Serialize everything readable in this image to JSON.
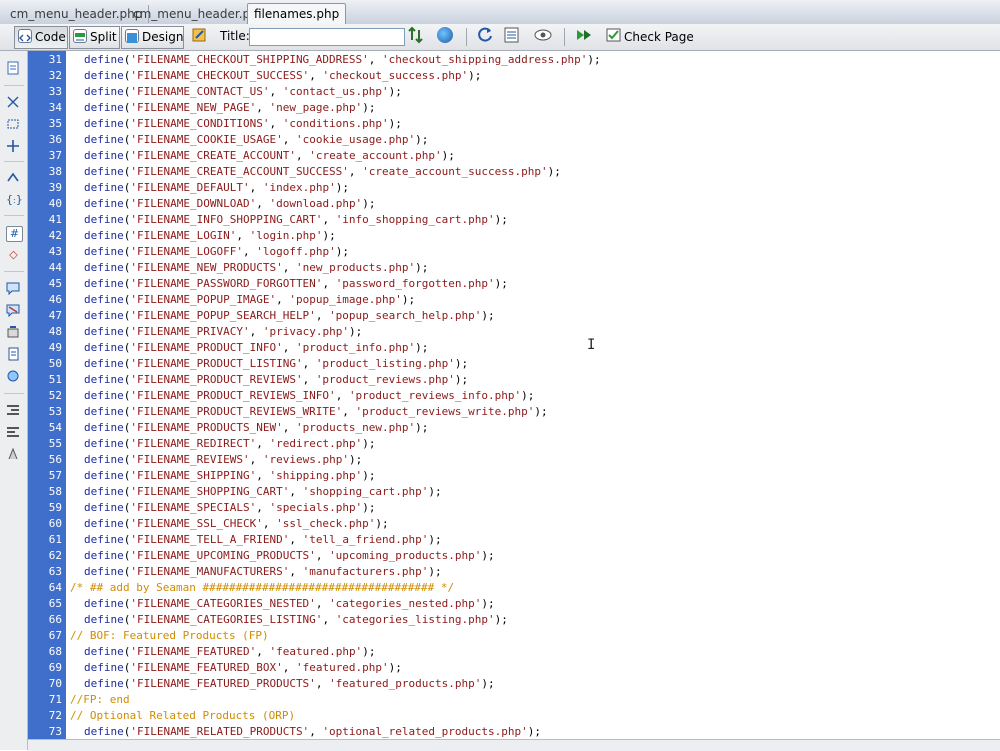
{
  "tabs": [
    {
      "label": "cm_menu_header.php",
      "active": false
    },
    {
      "label": "cm_menu_header.php",
      "active": false
    },
    {
      "label": "filenames.php",
      "active": true
    }
  ],
  "toolbar": {
    "code_label": "Code",
    "split_label": "Split",
    "design_label": "Design",
    "title_label": "Title:",
    "title_value": "",
    "check_page_label": "Check Page",
    "active_view": "Code"
  },
  "gutter_icons": [
    "document-icon",
    "collapse-icon",
    "expand-selection-icon",
    "expand-all-icon",
    "select-parent-icon",
    "balance-braces-icon",
    "line-numbers-icon",
    "highlight-invalid-icon",
    "apply-comment-icon",
    "remove-comment-icon",
    "wrap-tag-icon",
    "recent-snippets-icon",
    "move-css-icon",
    "indent-icon",
    "outdent-icon",
    "format-source-icon"
  ],
  "colors": {
    "gutter_blue": "#3f6fcb",
    "function": "#1f2b9c",
    "string": "#8b1a1a",
    "comment": "#d08c00",
    "highlight": "#fbe8ea"
  },
  "code": {
    "lines": [
      {
        "num": "31",
        "text": "define('FILENAME_CHECKOUT_SHIPPING_ADDRESS', 'checkout_shipping_address.php');"
      },
      {
        "num": "32",
        "text": "define('FILENAME_CHECKOUT_SUCCESS', 'checkout_success.php');"
      },
      {
        "num": "33",
        "text": "define('FILENAME_CONTACT_US', 'contact_us.php');"
      },
      {
        "num": "34",
        "text": "define('FILENAME_NEW_PAGE', 'new_page.php');",
        "highlight": true
      },
      {
        "num": "35",
        "text": "define('FILENAME_CONDITIONS', 'conditions.php');"
      },
      {
        "num": "36",
        "text": "define('FILENAME_COOKIE_USAGE', 'cookie_usage.php');"
      },
      {
        "num": "37",
        "text": "define('FILENAME_CREATE_ACCOUNT', 'create_account.php');"
      },
      {
        "num": "38",
        "text": "define('FILENAME_CREATE_ACCOUNT_SUCCESS', 'create_account_success.php');"
      },
      {
        "num": "39",
        "text": "define('FILENAME_DEFAULT', 'index.php');"
      },
      {
        "num": "40",
        "text": "define('FILENAME_DOWNLOAD', 'download.php');"
      },
      {
        "num": "41",
        "text": "define('FILENAME_INFO_SHOPPING_CART', 'info_shopping_cart.php');"
      },
      {
        "num": "42",
        "text": "define('FILENAME_LOGIN', 'login.php');"
      },
      {
        "num": "43",
        "text": "define('FILENAME_LOGOFF', 'logoff.php');"
      },
      {
        "num": "44",
        "text": "define('FILENAME_NEW_PRODUCTS', 'new_products.php');"
      },
      {
        "num": "45",
        "text": "define('FILENAME_PASSWORD_FORGOTTEN', 'password_forgotten.php');"
      },
      {
        "num": "46",
        "text": "define('FILENAME_POPUP_IMAGE', 'popup_image.php');"
      },
      {
        "num": "47",
        "text": "define('FILENAME_POPUP_SEARCH_HELP', 'popup_search_help.php');"
      },
      {
        "num": "48",
        "text": "define('FILENAME_PRIVACY', 'privacy.php');"
      },
      {
        "num": "49",
        "text": "define('FILENAME_PRODUCT_INFO', 'product_info.php');"
      },
      {
        "num": "50",
        "text": "define('FILENAME_PRODUCT_LISTING', 'product_listing.php');"
      },
      {
        "num": "51",
        "text": "define('FILENAME_PRODUCT_REVIEWS', 'product_reviews.php');"
      },
      {
        "num": "52",
        "text": "define('FILENAME_PRODUCT_REVIEWS_INFO', 'product_reviews_info.php');"
      },
      {
        "num": "53",
        "text": "define('FILENAME_PRODUCT_REVIEWS_WRITE', 'product_reviews_write.php');"
      },
      {
        "num": "54",
        "text": "define('FILENAME_PRODUCTS_NEW', 'products_new.php');"
      },
      {
        "num": "55",
        "text": "define('FILENAME_REDIRECT', 'redirect.php');"
      },
      {
        "num": "56",
        "text": "define('FILENAME_REVIEWS', 'reviews.php');"
      },
      {
        "num": "57",
        "text": "define('FILENAME_SHIPPING', 'shipping.php');"
      },
      {
        "num": "58",
        "text": "define('FILENAME_SHOPPING_CART', 'shopping_cart.php');"
      },
      {
        "num": "59",
        "text": "define('FILENAME_SPECIALS', 'specials.php');"
      },
      {
        "num": "60",
        "text": "define('FILENAME_SSL_CHECK', 'ssl_check.php');"
      },
      {
        "num": "61",
        "text": "define('FILENAME_TELL_A_FRIEND', 'tell_a_friend.php');"
      },
      {
        "num": "62",
        "text": "define('FILENAME_UPCOMING_PRODUCTS', 'upcoming_products.php');"
      },
      {
        "num": "63",
        "text": "define('FILENAME_MANUFACTURERS', 'manufacturers.php');"
      },
      {
        "num": "64",
        "text": "/* ## add by Seaman ################################### */",
        "comment": true
      },
      {
        "num": "65",
        "text": "define('FILENAME_CATEGORIES_NESTED', 'categories_nested.php');"
      },
      {
        "num": "66",
        "text": "define('FILENAME_CATEGORIES_LISTING', 'categories_listing.php');"
      },
      {
        "num": "67",
        "text": "// BOF: Featured Products (FP)",
        "comment": true
      },
      {
        "num": "68",
        "text": "define('FILENAME_FEATURED', 'featured.php');"
      },
      {
        "num": "69",
        "text": "define('FILENAME_FEATURED_BOX', 'featured.php');"
      },
      {
        "num": "70",
        "text": "define('FILENAME_FEATURED_PRODUCTS', 'featured_products.php');"
      },
      {
        "num": "71",
        "text": "//FP: end",
        "comment": true
      },
      {
        "num": "72",
        "text": "// Optional Related Products (ORP)",
        "comment": true
      },
      {
        "num": "73",
        "text": "define('FILENAME_RELATED_PRODUCTS', 'optional_related_products.php');"
      }
    ]
  }
}
